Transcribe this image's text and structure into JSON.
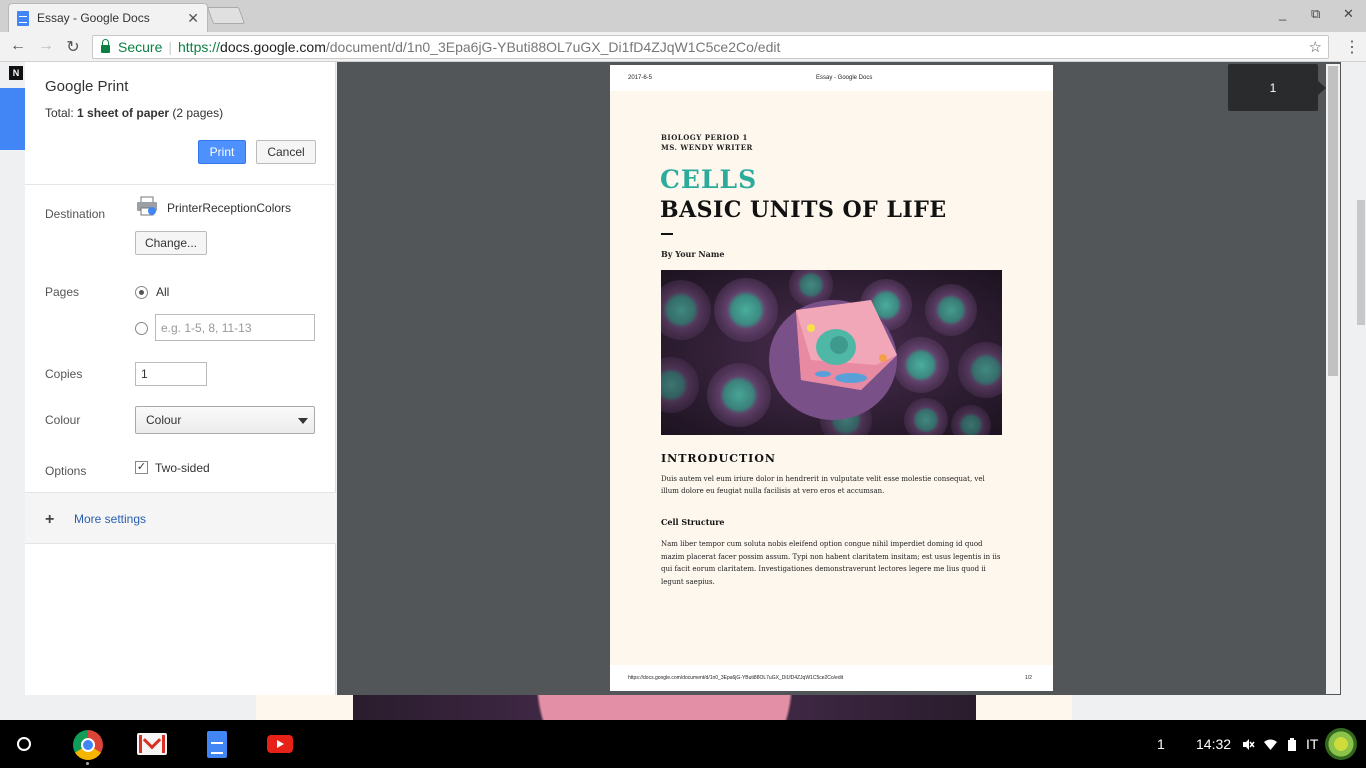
{
  "browser": {
    "tab_title": "Essay - Google Docs",
    "tab_close": "✕",
    "secure_label": "Secure",
    "url_scheme": "https://",
    "url_host": "docs.google.com",
    "url_path": "/document/d/1n0_3Epa6jG-YButi88OL7uGX_Di1fD4ZJqW1C5ce2Co/edit",
    "window_controls": [
      "_",
      "⧉",
      "✕"
    ]
  },
  "print_dialog": {
    "title": "Google Print",
    "total_prefix": "Total: ",
    "total_bold": "1 sheet of paper",
    "total_suffix": " (2 pages)",
    "print_label": "Print",
    "cancel_label": "Cancel",
    "destination_label": "Destination",
    "printer_name": "PrinterReceptionColors",
    "change_label": "Change...",
    "pages_label": "Pages",
    "pages_all_label": "All",
    "pages_custom_placeholder": "e.g. 1-5, 8, 11-13",
    "copies_label": "Copies",
    "copies_value": "1",
    "colour_label": "Colour",
    "colour_value": "Colour",
    "options_label": "Options",
    "two_sided_label": "Two-sided",
    "more_settings_label": "More settings"
  },
  "preview": {
    "page_number": "1",
    "header_date": "2017-6-5",
    "header_title": "Essay - Google Docs",
    "footer_url": "https://docs.google.com/document/d/1n0_3Epa6jG-YButi88OL7uGX_Di1fD4ZJqW1C5ce2Co/edit",
    "footer_page": "1/2",
    "course_line1": "BIOLOGY PERIOD 1",
    "course_line2": "MS. WENDY WRITER",
    "title_accent": "CELLS",
    "title_main": "BASIC UNITS OF LIFE",
    "author": "By Your Name",
    "intro_heading": "INTRODUCTION",
    "intro_text": "Duis autem vel eum iriure dolor in hendrerit in vulputate velit esse molestie consequat, vel illum dolore eu feugiat nulla facilisis at vero eros et accumsan.",
    "cell_heading": "Cell Structure",
    "cell_text": "Nam liber tempor cum soluta nobis eleifend option congue nihil imperdiet doming id quod mazim placerat facer possim assum. Typi non habent claritatem insitam; est usus legentis in iis qui facit eorum claritatem. Investigationes demonstraverunt lectores legere me lius quod ii legunt saepius."
  },
  "shelf": {
    "apps": [
      "chrome-icon",
      "gmail-icon",
      "docs-icon",
      "youtube-icon"
    ],
    "notification_count": "1",
    "time": "14:32",
    "locale": "IT"
  },
  "colors": {
    "accent_teal": "#2bab9c",
    "print_blue": "#4d90fe",
    "preview_bg": "#525659",
    "page_bg": "#fdf7ee"
  }
}
